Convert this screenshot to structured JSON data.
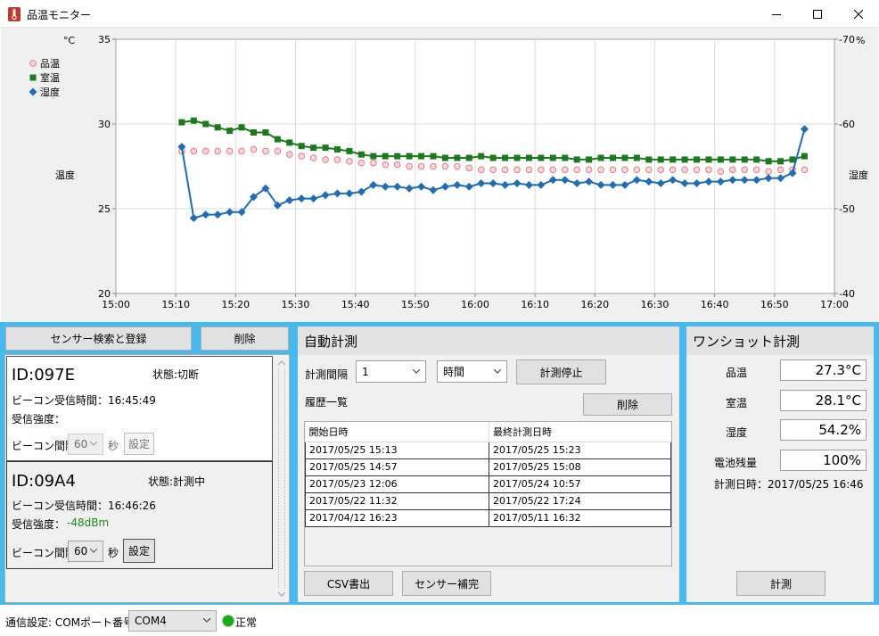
{
  "window": {
    "title": "品温モニター"
  },
  "colors": {
    "band": "#47b9ee",
    "series_hinon": "#e07a85",
    "series_shitsuon": "#1b7a1b",
    "series_shitsudo": "#1f6eb4",
    "status_ok": "#1aaa1a",
    "signal": "#1a8a1a"
  },
  "chart_data": {
    "type": "line",
    "ylabel_left": "温度",
    "ylabel_right": "湿度",
    "yunit_left": "°C",
    "yunit_right": "%",
    "ylim_left": [
      20,
      35
    ],
    "ylim_right": [
      40,
      70
    ],
    "yticks_left": [
      20,
      25,
      30,
      35
    ],
    "yticks_right": [
      40,
      50,
      60,
      70
    ],
    "xticks": [
      "15:00",
      "15:10",
      "15:20",
      "15:30",
      "15:40",
      "15:50",
      "16:00",
      "16:10",
      "16:20",
      "16:30",
      "16:40",
      "16:50",
      "17:00"
    ],
    "xrange_minutes": [
      0,
      120
    ],
    "grid": true,
    "legend_position": "top-left",
    "x_minutes": [
      11,
      13,
      15,
      17,
      19,
      21,
      23,
      25,
      27,
      29,
      31,
      33,
      35,
      37,
      39,
      41,
      43,
      45,
      47,
      49,
      51,
      53,
      55,
      57,
      59,
      61,
      63,
      65,
      67,
      69,
      71,
      73,
      75,
      77,
      79,
      81,
      83,
      85,
      87,
      89,
      91,
      93,
      95,
      97,
      99,
      101,
      103,
      105,
      107,
      109,
      111,
      113,
      115
    ],
    "series": [
      {
        "name": "品温",
        "axis": "left",
        "marker": "circle",
        "values": [
          28.4,
          28.4,
          28.4,
          28.4,
          28.4,
          28.4,
          28.5,
          28.4,
          28.4,
          28.2,
          28.1,
          28.0,
          27.9,
          27.9,
          27.8,
          27.7,
          27.7,
          27.6,
          27.6,
          27.5,
          27.5,
          27.5,
          27.5,
          27.5,
          27.4,
          27.3,
          27.3,
          27.3,
          27.3,
          27.3,
          27.3,
          27.3,
          27.3,
          27.3,
          27.3,
          27.3,
          27.3,
          27.3,
          27.3,
          27.3,
          27.3,
          27.3,
          27.3,
          27.3,
          27.3,
          27.2,
          27.3,
          27.3,
          27.3,
          27.2,
          27.3,
          27.3,
          27.3
        ]
      },
      {
        "name": "室温",
        "axis": "left",
        "marker": "square",
        "values": [
          30.1,
          30.2,
          30.0,
          29.8,
          29.6,
          29.8,
          29.5,
          29.5,
          29.1,
          28.9,
          28.7,
          28.6,
          28.6,
          28.5,
          28.4,
          28.2,
          28.1,
          28.1,
          28.1,
          28.1,
          28.1,
          28.1,
          28.0,
          28.0,
          28.0,
          28.1,
          28.0,
          28.0,
          28.0,
          28.0,
          28.0,
          28.0,
          28.0,
          27.9,
          27.9,
          28.0,
          28.0,
          28.0,
          28.0,
          27.9,
          27.9,
          27.9,
          27.9,
          27.9,
          27.9,
          27.9,
          27.9,
          27.9,
          27.9,
          27.8,
          27.8,
          27.9,
          28.1
        ]
      },
      {
        "name": "湿度",
        "axis": "right",
        "marker": "diamond",
        "values": [
          57.3,
          48.9,
          49.3,
          49.3,
          49.6,
          49.6,
          51.4,
          52.4,
          50.4,
          51.0,
          51.2,
          51.2,
          51.6,
          51.8,
          51.8,
          52.0,
          52.8,
          52.6,
          52.6,
          52.4,
          52.6,
          52.2,
          52.6,
          52.8,
          52.6,
          53.0,
          53.0,
          52.8,
          53.0,
          52.8,
          52.8,
          53.4,
          53.4,
          53.0,
          53.2,
          52.8,
          52.8,
          52.8,
          53.4,
          53.2,
          53.0,
          53.4,
          53.0,
          53.0,
          53.2,
          53.2,
          53.4,
          53.4,
          53.4,
          53.6,
          53.6,
          54.2,
          59.4
        ]
      }
    ]
  },
  "sensor_list": {
    "search_button": "センサー検索と登録",
    "delete_button": "削除",
    "cards": [
      {
        "id": "ID:097E",
        "status": "状態:切断",
        "beacon_time": "ビーコン受信時間：16:45:49",
        "signal_label": "受信強度：",
        "signal_value": "",
        "interval_label": "ビーコン間隔",
        "interval_value": "60",
        "unit": "秒",
        "set_button": "設定",
        "disabled": true
      },
      {
        "id": "ID:09A4",
        "status": "状態:計測中",
        "beacon_time": "ビーコン受信時間：16:46:26",
        "signal_label": "受信強度：",
        "signal_value": "-48dBm",
        "interval_label": "ビーコン間隔",
        "interval_value": "60",
        "unit": "秒",
        "set_button": "設定",
        "disabled": false
      }
    ]
  },
  "auto": {
    "header": "自動計測",
    "interval_label": "計測間隔",
    "interval_value": "1",
    "unit_value": "時間",
    "stop_button": "計測停止",
    "history_label": "履歴一覧",
    "delete_button": "削除",
    "columns": [
      "開始日時",
      "最終計測日時"
    ],
    "rows": [
      [
        "2017/05/25 15:13",
        "2017/05/25 15:23"
      ],
      [
        "2017/05/25 14:57",
        "2017/05/25 15:08"
      ],
      [
        "2017/05/23 12:06",
        "2017/05/24 10:57"
      ],
      [
        "2017/05/22 11:32",
        "2017/05/22 17:24"
      ],
      [
        "2017/04/12 16:23",
        "2017/05/11 16:32"
      ]
    ],
    "csv_button": "CSV書出",
    "calib_button": "センサー補完"
  },
  "oneshot": {
    "header": "ワンショット計測",
    "items": [
      {
        "label": "品温",
        "value": "27.3°C"
      },
      {
        "label": "室温",
        "value": "28.1°C"
      },
      {
        "label": "湿度",
        "value": "54.2%"
      },
      {
        "label": "電池残量",
        "value": "100%"
      }
    ],
    "datetime": "計測日時：2017/05/25 16:46",
    "measure_button": "計測"
  },
  "statusbar": {
    "com_label": "通信設定: COMポート番号",
    "com_value": "COM4",
    "status_text": "正常"
  }
}
